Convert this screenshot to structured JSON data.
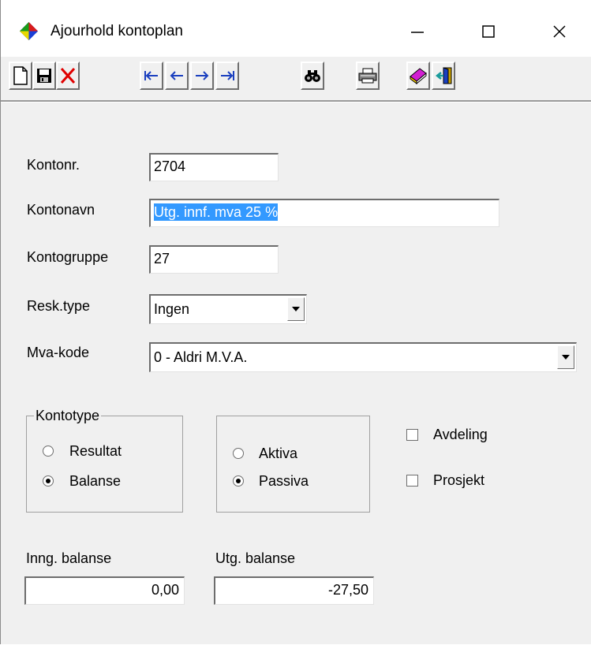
{
  "window": {
    "title": "Ajourhold kontoplan",
    "icons": [
      "app-icon",
      "minimize-icon",
      "maximize-icon",
      "close-icon"
    ]
  },
  "toolbar": {
    "buttons": [
      {
        "name": "new-document-icon"
      },
      {
        "name": "save-icon"
      },
      {
        "name": "delete-icon"
      },
      {
        "name": "first-record-icon"
      },
      {
        "name": "previous-record-icon"
      },
      {
        "name": "next-record-icon"
      },
      {
        "name": "last-record-icon"
      },
      {
        "name": "binoculars-search-icon"
      },
      {
        "name": "printer-icon"
      },
      {
        "name": "book-icon"
      },
      {
        "name": "exit-door-icon"
      }
    ]
  },
  "form": {
    "kontonr_label": "Kontonr.",
    "kontonr_value": "2704",
    "kontonavn_label": "Kontonavn",
    "kontonavn_value": "Utg. innf. mva 25 %",
    "kontogruppe_label": "Kontogruppe",
    "kontogruppe_value": "27",
    "resktype_label": "Resk.type",
    "resktype_value": "Ingen",
    "mvakode_label": "Mva-kode",
    "mvakode_value": "0 - Aldri M.V.A."
  },
  "kontotype": {
    "caption": "Kontotype",
    "options": [
      {
        "label": "Resultat",
        "checked": false
      },
      {
        "label": "Balanse",
        "checked": true
      }
    ]
  },
  "aktiva_passiva": {
    "options": [
      {
        "label": "Aktiva",
        "checked": false
      },
      {
        "label": "Passiva",
        "checked": true
      }
    ]
  },
  "checkboxes": [
    {
      "label": "Avdeling",
      "checked": false
    },
    {
      "label": "Prosjekt",
      "checked": false
    }
  ],
  "balances": {
    "inng_label": "Inng. balanse",
    "inng_value": "0,00",
    "utg_label": "Utg. balanse",
    "utg_value": "-27,50"
  },
  "colors": {
    "selection": "#3399ff",
    "window_bg": "#f0f0f0",
    "delete_red": "#e00000",
    "arrow_blue": "#1a3fbf"
  }
}
